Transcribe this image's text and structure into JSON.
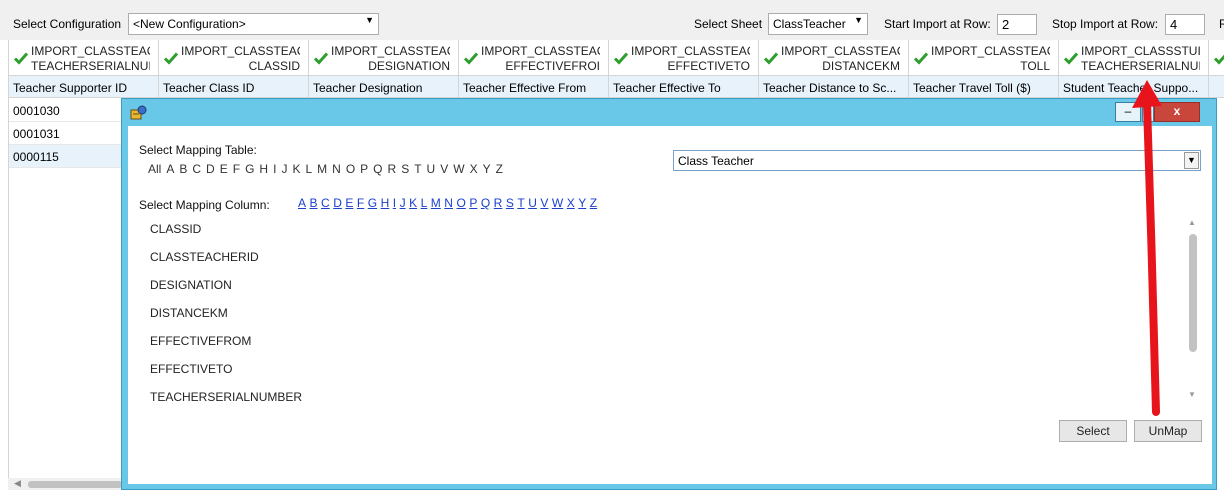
{
  "toolbar": {
    "config_label": "Select Configuration",
    "config_value": "<New Configuration>",
    "sheet_label": "Select Sheet",
    "sheet_value": "ClassTeacher",
    "start_label": "Start Import at Row:",
    "start_value": "2",
    "stop_label": "Stop Import at Row:",
    "stop_value": "4",
    "trailing_label": "R"
  },
  "grid": {
    "headers": [
      {
        "line1": "IMPORT_CLASSTEAC",
        "line2": "TEACHERSERIALNUI"
      },
      {
        "line1": "IMPORT_CLASSTEAC",
        "line2": "CLASSID"
      },
      {
        "line1": "IMPORT_CLASSTEAC",
        "line2": "DESIGNATION"
      },
      {
        "line1": "IMPORT_CLASSTEAC",
        "line2": "EFFECTIVEFROI"
      },
      {
        "line1": "IMPORT_CLASSTEAC",
        "line2": "EFFECTIVETO"
      },
      {
        "line1": "IMPORT_CLASSTEAC",
        "line2": "DISTANCEKM"
      },
      {
        "line1": "IMPORT_CLASSTEAC",
        "line2": "TOLL"
      },
      {
        "line1": "IMPORT_CLASSSTUI",
        "line2": "TEACHERSERIALNUI"
      }
    ],
    "mappings": [
      "Teacher Supporter ID",
      "Teacher Class ID",
      "Teacher Designation",
      "Teacher Effective From",
      "Teacher Effective To",
      "Teacher Distance to Sc...",
      "Teacher Travel Toll ($)",
      "Student Teacher Suppo..."
    ],
    "rows": [
      "0001030",
      "0001031",
      "0000115"
    ]
  },
  "dialog": {
    "minimize_glyph": "–",
    "maximize_glyph": "□",
    "close_glyph": "x",
    "table_label": "Select Mapping Table:",
    "table_value": "Class Teacher",
    "table_filter": [
      "All",
      "A",
      "B",
      "C",
      "D",
      "E",
      "F",
      "G",
      "H",
      "I",
      "J",
      "K",
      "L",
      "M",
      "N",
      "O",
      "P",
      "Q",
      "R",
      "S",
      "T",
      "U",
      "V",
      "W",
      "X",
      "Y",
      "Z"
    ],
    "column_label": "Select Mapping Column:",
    "column_filter": [
      "A",
      "B",
      "C",
      "D",
      "E",
      "F",
      "G",
      "H",
      "I",
      "J",
      "K",
      "L",
      "M",
      "N",
      "O",
      "P",
      "Q",
      "R",
      "S",
      "T",
      "U",
      "V",
      "W",
      "X",
      "Y",
      "Z"
    ],
    "columns": [
      "CLASSID",
      "CLASSTEACHERID",
      "DESIGNATION",
      "DISTANCEKM",
      "EFFECTIVEFROM",
      "EFFECTIVETO",
      "TEACHERSERIALNUMBER"
    ],
    "select_button": "Select",
    "unmap_button": "UnMap"
  },
  "colors": {
    "dialog_bg": "#69c8e8",
    "mapping_row_bg": "#e8f2fb",
    "check_green": "#2e9e2e",
    "close_red": "#c9463d",
    "arrow_red": "#e8141b",
    "link_blue": "#1a3fcc"
  },
  "icons": [
    "check-icon",
    "app-icon",
    "dropdown-arrow-icon",
    "minimize-icon",
    "maximize-icon",
    "close-icon",
    "annotation-arrow"
  ]
}
